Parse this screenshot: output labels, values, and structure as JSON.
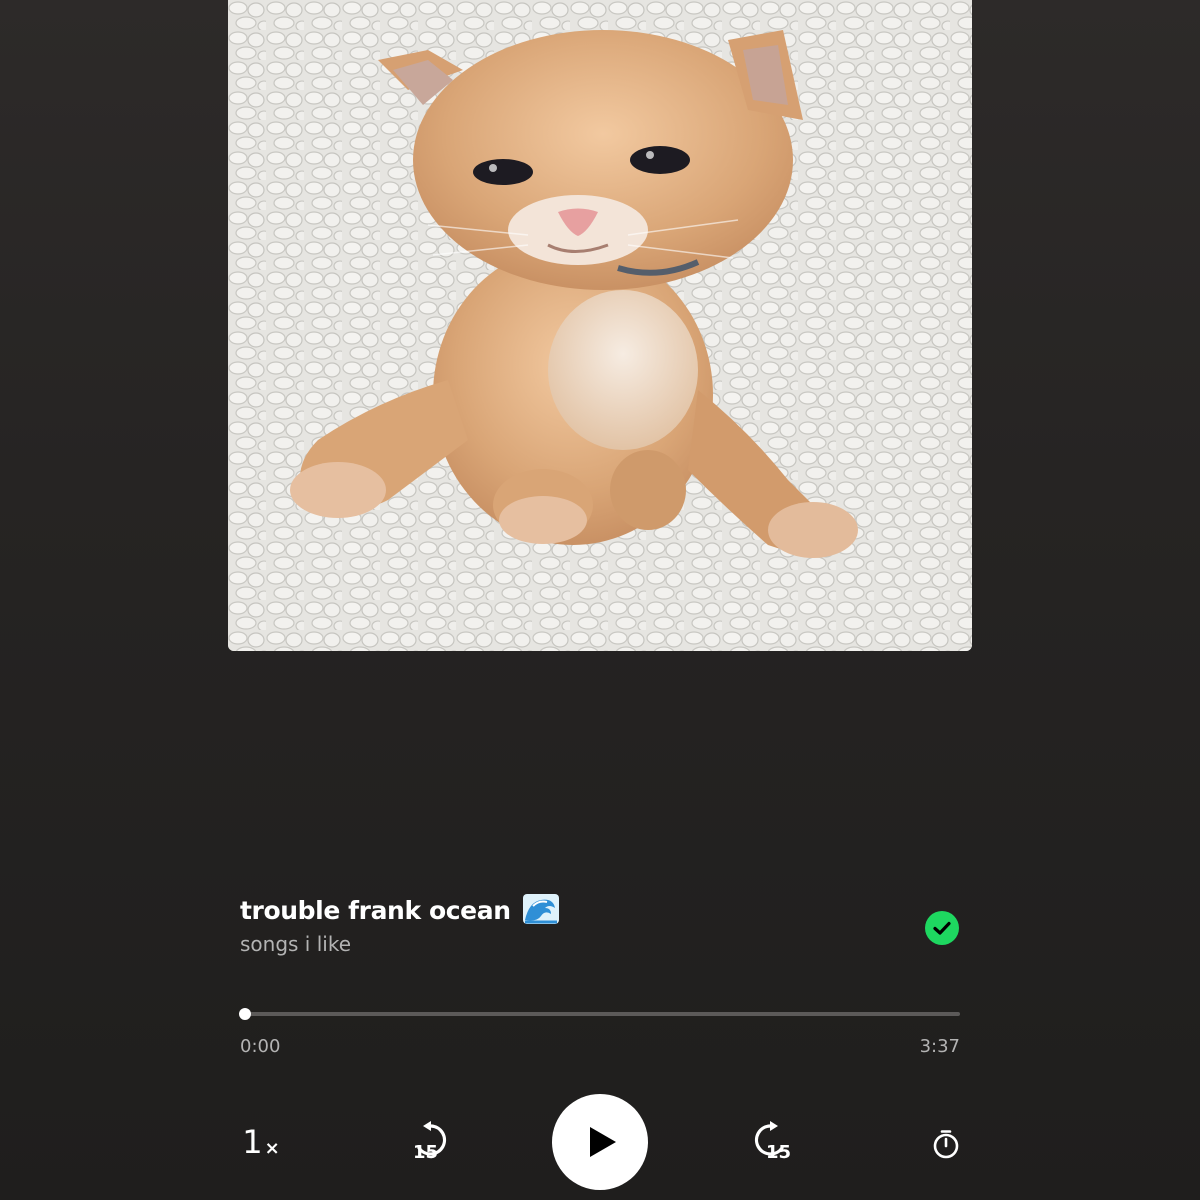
{
  "track": {
    "title": "trouble frank ocean",
    "title_emoji_icon": "water-wave-icon",
    "source": "songs i like",
    "saved_icon": "check-circle-icon",
    "saved_color": "#1ed760"
  },
  "progress": {
    "elapsed": "0:00",
    "duration": "3:37",
    "fraction": 0.0
  },
  "controls": {
    "speed_value": "1",
    "speed_suffix": "×",
    "skip_back_seconds": "15",
    "play_icon": "play-icon",
    "skip_forward_seconds": "15",
    "sleep_timer_icon": "stopwatch-icon"
  },
  "artwork": {
    "subject_icon": "kitten-artwork"
  }
}
